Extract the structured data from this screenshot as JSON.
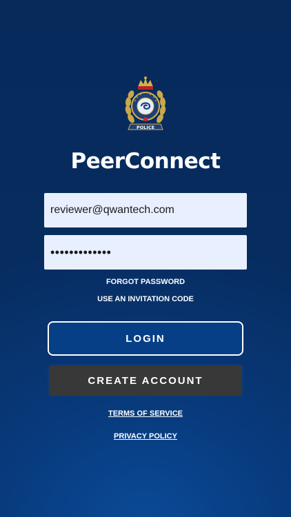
{
  "app": {
    "title": "PeerConnect",
    "logo_icon": "police-crest-icon",
    "logo_text": "POLICE"
  },
  "login_form": {
    "email_value": "reviewer@qwantech.com",
    "password_value": "•••••••••••••"
  },
  "links": {
    "forgot_password": "FORGOT PASSWORD",
    "invitation_code": "USE AN INVITATION CODE",
    "terms": "TERMS OF SERVICE",
    "privacy": "PRIVACY POLICY"
  },
  "buttons": {
    "login": "LOGIN",
    "create_account": "CREATE ACCOUNT"
  },
  "colors": {
    "background_top": "#072a5b",
    "background_bottom": "#0a4a98",
    "field_bg": "#e8efff",
    "login_bg": "#063f85",
    "create_bg": "#383838"
  }
}
